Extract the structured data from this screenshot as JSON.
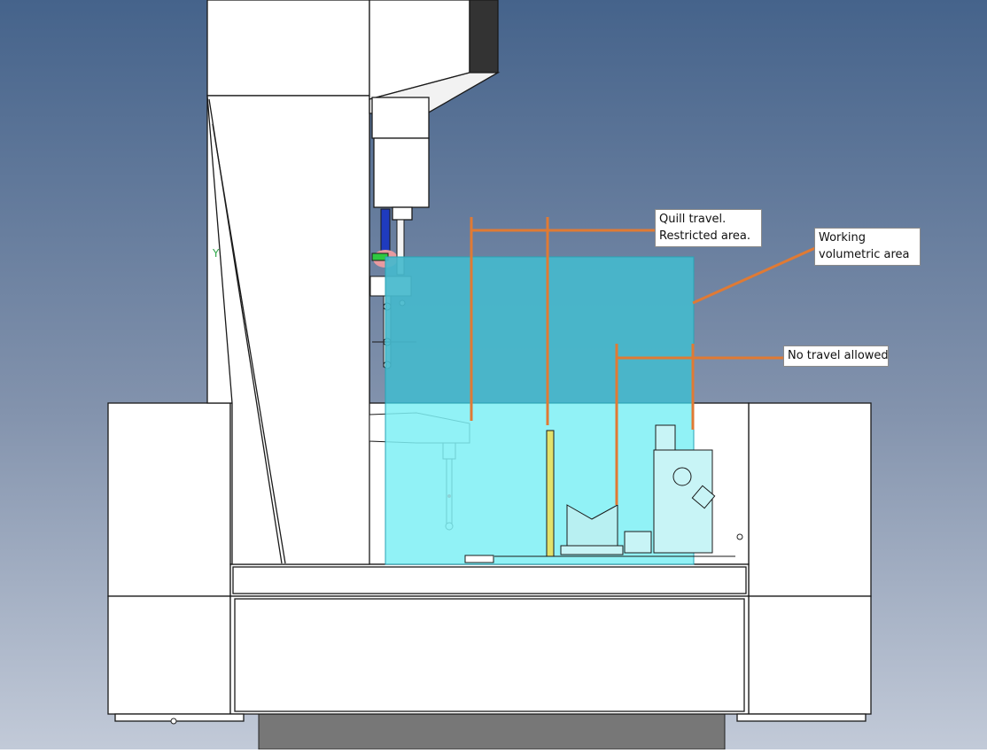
{
  "axis": {
    "y_label": "Y"
  },
  "callouts": {
    "quill_travel": {
      "line1": "Quill travel.",
      "line2": "Restricted area."
    },
    "working_volume": {
      "line1": "Working",
      "line2": "volumetric area"
    },
    "no_travel": {
      "line1": "No travel allowed"
    }
  },
  "colors": {
    "background_top": "#4a6890",
    "background_bottom": "#b9c3d4",
    "annotation_orange": "#e07a34",
    "volume_fill": "#3ee6f0",
    "machine_white": "#ffffff",
    "outline": "#1a1a1a",
    "base_gray": "#7a7a7a"
  }
}
